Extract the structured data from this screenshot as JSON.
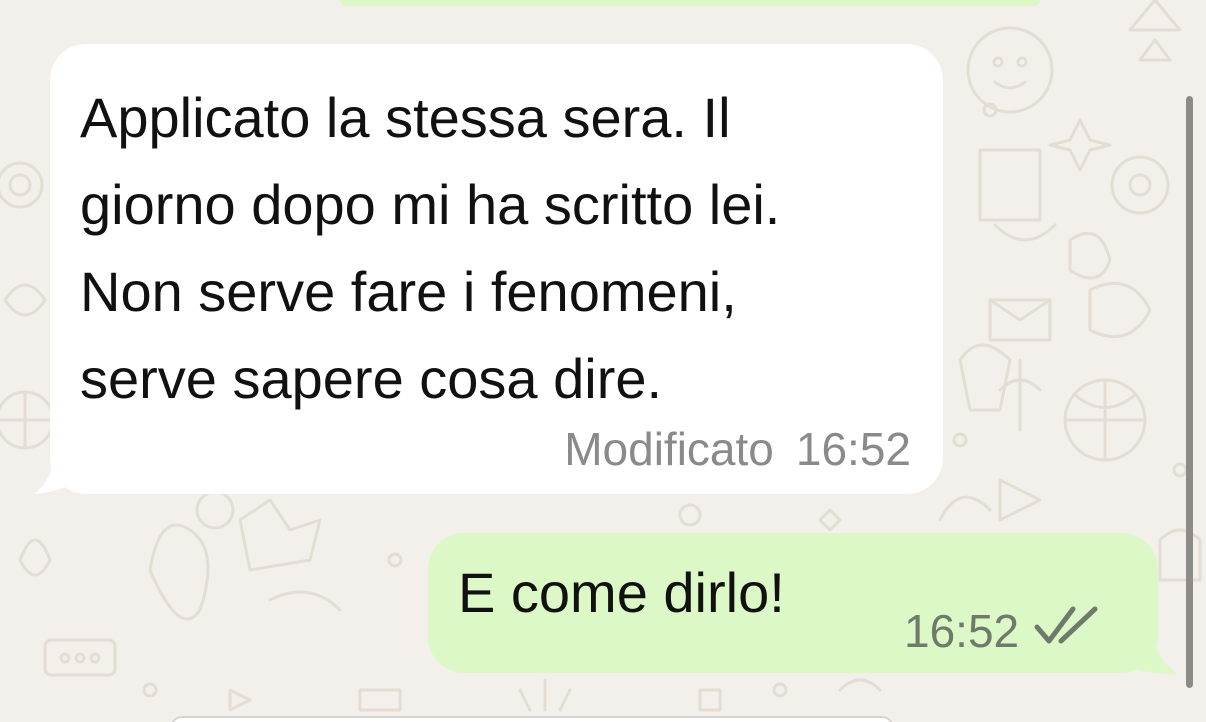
{
  "conversation": {
    "incoming_message": {
      "lines": [
        "Applicato la stessa sera. Il",
        "giorno dopo mi ha scritto lei.",
        "Non serve fare i fenomeni,",
        "serve sapere cosa dire."
      ],
      "edited_label": "Modificato",
      "time": "16:52"
    },
    "outgoing_message": {
      "text": "E come dirlo!",
      "time": "16:52",
      "status_icon": "double-check-icon"
    }
  },
  "colors": {
    "wallpaper": "#f3f0eb",
    "incoming_bubble": "#ffffff",
    "outgoing_bubble": "#dcf8c6",
    "text": "#111111",
    "meta_incoming": "#8a8a8a",
    "meta_outgoing": "#6f7a6a"
  }
}
